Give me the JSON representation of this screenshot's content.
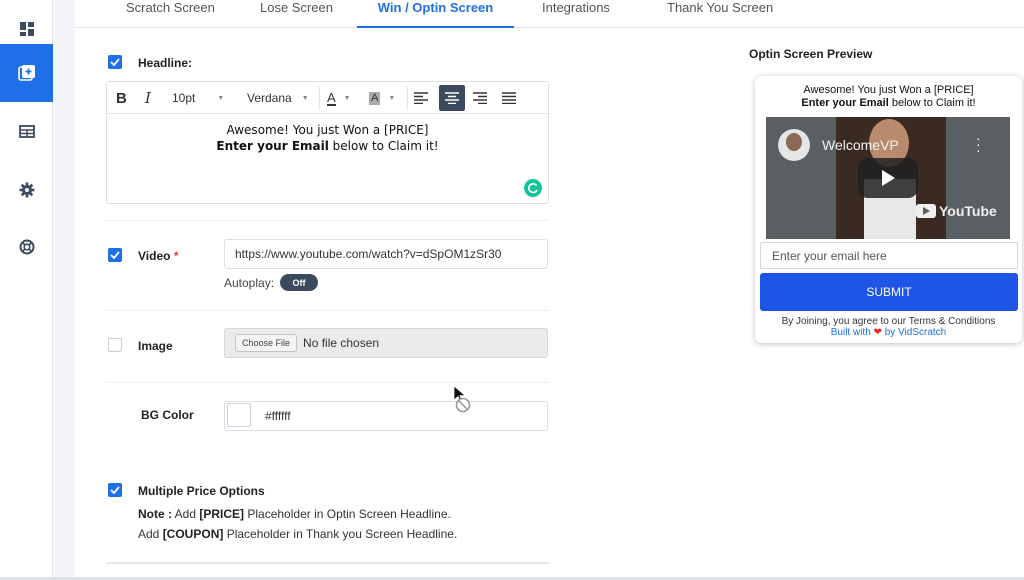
{
  "colors": {
    "accent": "#1f6fe8",
    "submit": "#1f55e6",
    "toggle": "#3b4a5e",
    "heart": "#e0252b"
  },
  "rail": {
    "items": [
      {
        "icon": "dashboard-icon",
        "active": false
      },
      {
        "icon": "add-square-icon",
        "active": true
      },
      {
        "icon": "table-icon",
        "active": false
      },
      {
        "icon": "gear-icon",
        "active": false
      },
      {
        "icon": "lifebuoy-icon",
        "active": false
      }
    ]
  },
  "tabs": [
    {
      "label": "Scratch Screen"
    },
    {
      "label": "Lose Screen"
    },
    {
      "label": "Win / Optin Screen"
    },
    {
      "label": "Integrations"
    },
    {
      "label": "Thank You Screen"
    }
  ],
  "headline": {
    "label": "Headline:",
    "checked": true,
    "toolbar": {
      "bold": "B",
      "italic": "I",
      "font_size": "10pt",
      "font_family": "Verdana",
      "font_color": "A",
      "bg_color": "A",
      "align": [
        "align-left-icon",
        "align-center-icon",
        "align-right-icon",
        "align-justify-icon"
      ]
    },
    "line1": "Awesome! You just Won a [PRICE]",
    "line2_bold": "Enter your Email",
    "line2_rest": " below to Claim it!"
  },
  "video": {
    "label": "Video",
    "required_mark": "*",
    "checked": true,
    "url": "https://www.youtube.com/watch?v=dSpOM1zSr30",
    "autoplay_label": "Autoplay:",
    "autoplay_state": "Off"
  },
  "image": {
    "label": "Image",
    "checked": false,
    "choose_file": "Choose File",
    "no_file": "No file chosen"
  },
  "bg_color": {
    "label": "BG Color",
    "value": "#ffffff"
  },
  "multiple_price": {
    "label": "Multiple Price Options",
    "checked": true,
    "note_prefix": "Note :",
    "note_add": " Add ",
    "note_price": "[PRICE]",
    "note_rest1": " Placeholder in Optin Screen Headline.",
    "note2_add": "Add ",
    "note_coupon": "[COUPON]",
    "note_rest2": " Placeholder in Thank you Screen Headline."
  },
  "preview": {
    "title": "Optin Screen Preview",
    "head_line1": "Awesome! You just Won a [PRICE]",
    "head_line2_bold": "Enter your Email",
    "head_line2_rest": " below to Claim it!",
    "video_channel": "WelcomeVP",
    "video_brand": "YouTube",
    "email_placeholder": "Enter your email here",
    "submit_label": "SUBMIT",
    "terms": "By Joining, you agree to our Terms & Conditions",
    "built_with": "Built with",
    "built_by": "by VidScratch"
  }
}
